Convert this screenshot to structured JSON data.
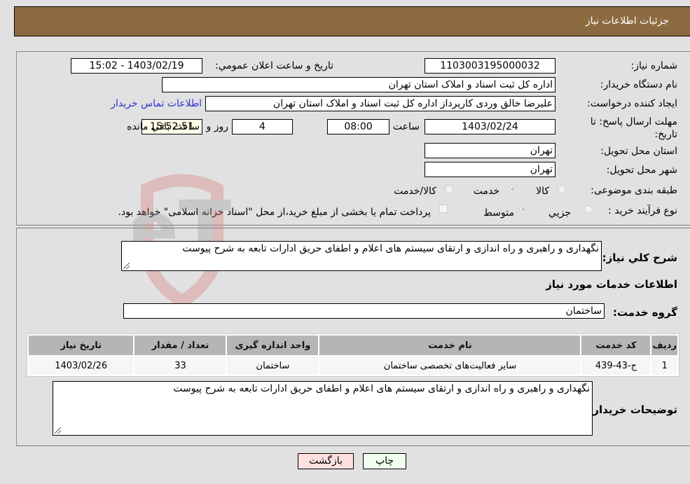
{
  "header": {
    "title": "جزئیات اطلاعات نیاز"
  },
  "form": {
    "need_number_label": "شماره نیاز:",
    "need_number": "1103003195000032",
    "announce_label": "تاریخ و ساعت اعلان عمومي:",
    "announce_value": "1403/02/19 - 15:02",
    "buyer_org_label": "نام دستگاه خریدار:",
    "buyer_org": "اداره کل ثبت اسناد و املاک استان تهران",
    "creator_label": "ایجاد کننده درخواست:",
    "creator": "علیرضا خالق وردی کارپرداز اداره کل ثبت اسناد و املاک استان تهران",
    "contact_link": "اطلاعات تماس خریدار",
    "deadline_label": "مهلت ارسال پاسخ: تا تاریخ:",
    "deadline_date": "1403/02/24",
    "time_label": "ساعت",
    "deadline_time": "08:00",
    "days_value": "4",
    "days_label": "روز و",
    "remaining_time": "15:52:51",
    "remaining_label": "ساعت باقي مانده",
    "province_label": "استان محل تحویل:",
    "province": "تهران",
    "city_label": "شهر محل تحویل:",
    "city": "تهران",
    "category_label": "طبقه بندی موضوعی:",
    "category_options": [
      {
        "label": "کالا",
        "selected": false
      },
      {
        "label": "خدمت",
        "selected": true
      },
      {
        "label": "کالا/خدمت",
        "selected": false
      }
    ],
    "process_label": "نوع فرآیند خرید :",
    "process_options": [
      {
        "label": "جزيي",
        "selected": false
      },
      {
        "label": "متوسط",
        "selected": true
      }
    ],
    "treasury_note": "پرداخت تمام یا بخشی از مبلغ خرید،از محل \"اسناد خزانه اسلامی\" خواهد بود."
  },
  "details": {
    "summary_label": "شرح کلي نیاز:",
    "summary": "نگهداری و راهبری و راه اندازی و ارتقای سیستم های اعلام و اطفای حریق ادارات تابعه به شرح پیوست",
    "services_heading": "اطلاعات خدمات مورد نیاز",
    "service_group_label": "گروه خدمت:",
    "service_group": "ساختمان",
    "table": {
      "headers": [
        "ردیف",
        "کد خدمت",
        "نام خدمت",
        "واحد اندازه گیری",
        "تعداد / مقدار",
        "تاریخ نیاز"
      ],
      "rows": [
        [
          "1",
          "ج-43-439",
          "سایر فعالیت‌های تخصصی ساختمان",
          "ساختمان",
          "33",
          "1403/02/26"
        ]
      ]
    },
    "buyer_notes_label": "توضیحات خریدار:",
    "buyer_notes": "نگهداری و راهبری و راه اندازی و ارتقای سیستم های اعلام و اطفای حریق ادارات تابعه به شرح پیوست"
  },
  "buttons": {
    "print": "چاپ",
    "back": "بازگشت"
  },
  "watermark": {
    "text": "AriaTender.neT"
  },
  "colors": {
    "header_bg": "#8c6b41",
    "link": "#2f2fd6",
    "print_bg": "#efffef",
    "back_bg": "#ffe0e0",
    "remaining_bg": "#fffde8"
  }
}
